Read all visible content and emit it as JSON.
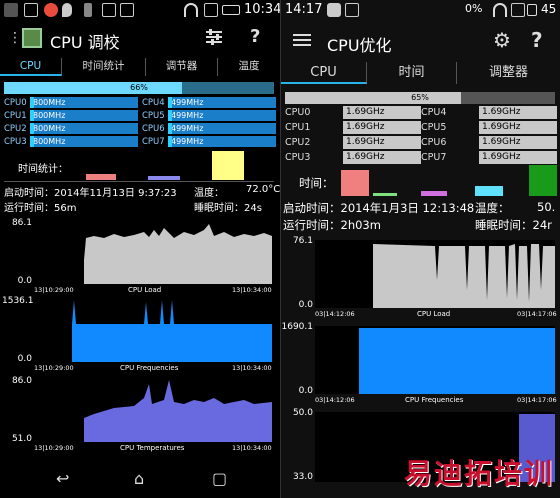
{
  "left": {
    "status": {
      "time": "10:34"
    },
    "app_title": "CPU 调校",
    "tabs": [
      "CPU",
      "时间统计",
      "调节器",
      "温度"
    ],
    "total_load": "66%",
    "total_fraction": 0.66,
    "cores": [
      {
        "label": "CPU0",
        "freq": "800MHz"
      },
      {
        "label": "CPU1",
        "freq": "800MHz"
      },
      {
        "label": "CPU2",
        "freq": "800MHz"
      },
      {
        "label": "CPU3",
        "freq": "800MHz"
      },
      {
        "label": "CPU4",
        "freq": "499MHz"
      },
      {
        "label": "CPU5",
        "freq": "499MHz"
      },
      {
        "label": "CPU6",
        "freq": "499MHz"
      },
      {
        "label": "CPU7",
        "freq": "499MHz"
      }
    ],
    "time_stats_label": "时间统计：",
    "boot_time_label": "启动时间：",
    "boot_time": "2014年11月13日 9:37:23",
    "temp_label": "温度：",
    "temp": "72.0°C",
    "uptime_label": "运行时间：",
    "uptime": "56m",
    "sleep_label": "睡眠时间：",
    "sleep": "24s",
    "graphs": [
      {
        "title": "CPU Load",
        "ymax": "86.1",
        "ymin": "0.0",
        "x_start": "13|10:29:00",
        "x_end": "13|10:34:00"
      },
      {
        "title": "CPU Frequencies",
        "ymax": "1536.1",
        "ymin": "0.0",
        "x_start": "13|10:29:00",
        "x_end": "13|10:34:00"
      },
      {
        "title": "CPU Temperatures",
        "ymax": "86.0",
        "ymin": "51.0",
        "x_start": "13|10:29:00",
        "x_end": "13|10:34:00"
      }
    ]
  },
  "right": {
    "status": {
      "time": "14:17",
      "battery": "0%",
      "battery2": "45"
    },
    "app_title": "CPU优化",
    "tabs": [
      "CPU",
      "时间",
      "调整器"
    ],
    "total_load": "65%",
    "total_fraction": 0.65,
    "cores": [
      {
        "label": "CPU0",
        "freq": "1.69GHz"
      },
      {
        "label": "CPU1",
        "freq": "1.69GHz"
      },
      {
        "label": "CPU2",
        "freq": "1.69GHz"
      },
      {
        "label": "CPU3",
        "freq": "1.69GHz"
      },
      {
        "label": "CPU4",
        "freq": "1.69GHz"
      },
      {
        "label": "CPU5",
        "freq": "1.69GHz"
      },
      {
        "label": "CPU6",
        "freq": "1.69GHz"
      },
      {
        "label": "CPU7",
        "freq": "1.69GHz"
      }
    ],
    "time_label": "时间：",
    "boot_time_label": "启动时间：",
    "boot_time": "2014年1月3日 12:13:48",
    "temp_label": "温度：",
    "temp": "50.",
    "uptime_label": "运行时间：",
    "uptime": "2h03m",
    "sleep_label": "睡眠时间：",
    "sleep": "24r",
    "graphs": [
      {
        "title": "CPU Load",
        "ymax": "76.1",
        "ymin": "0.0",
        "x_start": "03|14:12:06",
        "x_end": "03|14:17:06"
      },
      {
        "title": "CPU Frequencies",
        "ymax": "1690.1",
        "ymin": "0.0",
        "x_start": "03|14:12:06",
        "x_end": "03|14:17:06"
      },
      {
        "title": "",
        "ymax": "50.0",
        "ymin": "33.0",
        "x_start": "",
        "x_end": ""
      }
    ],
    "watermark": "易迪拓培训"
  },
  "colors": {
    "accent": "#26b4ea",
    "load_fill": "#c8c8c8",
    "freq_fill": "#1189ff",
    "temp_fill": "#6a6ae0"
  }
}
